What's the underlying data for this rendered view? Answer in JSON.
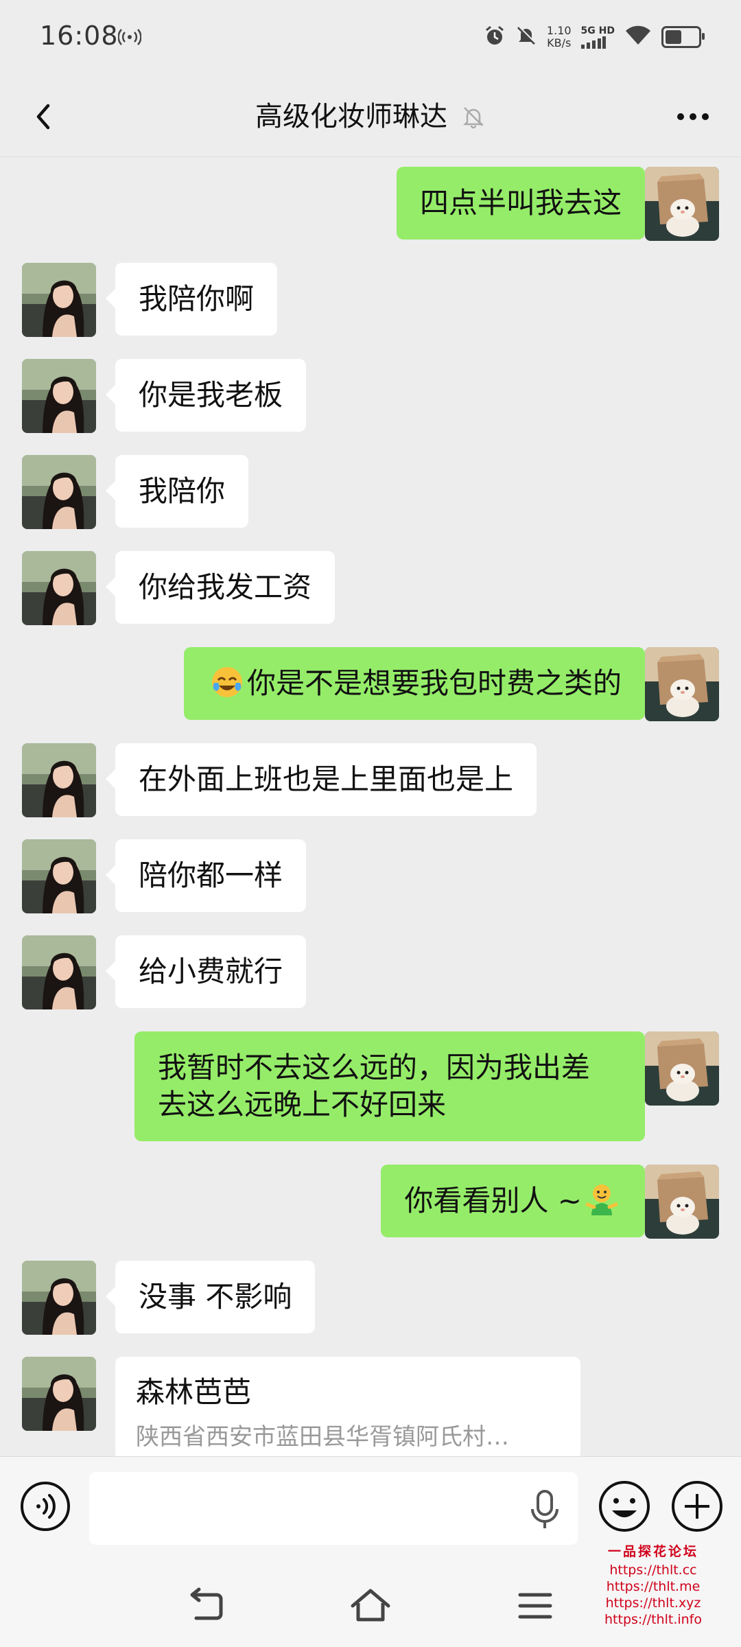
{
  "status_bar": {
    "time": "16:08",
    "net_speed_value": "1.10",
    "net_speed_unit": "KB/s",
    "network_type": "5G HD"
  },
  "header": {
    "title": "高级化妆师琳达",
    "muted": true
  },
  "messages": [
    {
      "side": "right",
      "text": "四点半叫我去这"
    },
    {
      "side": "left",
      "text": "我陪你啊"
    },
    {
      "side": "left",
      "text": "你是我老板"
    },
    {
      "side": "left",
      "text": "我陪你"
    },
    {
      "side": "left",
      "text": "你给我发工资"
    },
    {
      "side": "right",
      "emoji": "laughing-crying-emoji",
      "text": "你是不是想要我包时费之类的"
    },
    {
      "side": "left",
      "text": "在外面上班也是上里面也是上"
    },
    {
      "side": "left",
      "text": "陪你都一样"
    },
    {
      "side": "left",
      "text": "给小费就行"
    },
    {
      "side": "right",
      "line1": "我暂时不去这么远的，因为我出差",
      "line2": "去这么远晚上不好回来"
    },
    {
      "side": "right",
      "text": "你看看别人 ~",
      "emoji": "smiling-figure-emoji"
    },
    {
      "side": "left",
      "text": "没事 不影响"
    },
    {
      "side": "left",
      "type": "location",
      "title": "森林芭芭",
      "address": "陕西省西安市蓝田县华胥镇阿氏村…"
    }
  ],
  "input_bar": {
    "value": "",
    "placeholder": ""
  },
  "watermark": {
    "title": "一品探花论坛",
    "urls": [
      "https://thlt.cc",
      "https://thlt.me",
      "https://thlt.xyz",
      "https://thlt.info"
    ]
  },
  "colors": {
    "background": "#ededed",
    "sent_bubble": "#95ec69",
    "received_bubble": "#ffffff",
    "watermark": "#d0021b"
  }
}
